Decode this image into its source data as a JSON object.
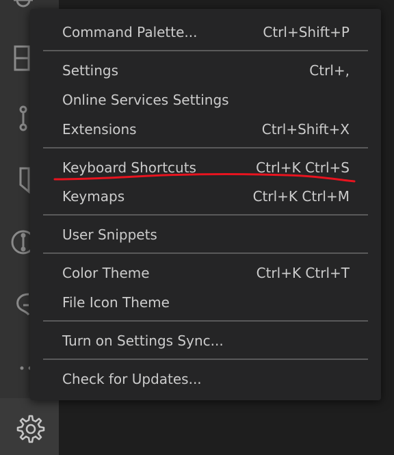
{
  "menu": {
    "items": [
      {
        "label": "Command Palette...",
        "shortcut": "Ctrl+Shift+P"
      },
      {
        "label": "Settings",
        "shortcut": "Ctrl+,"
      },
      {
        "label": "Online Services Settings",
        "shortcut": ""
      },
      {
        "label": "Extensions",
        "shortcut": "Ctrl+Shift+X"
      },
      {
        "label": "Keyboard Shortcuts",
        "shortcut": "Ctrl+K Ctrl+S"
      },
      {
        "label": "Keymaps",
        "shortcut": "Ctrl+K Ctrl+M"
      },
      {
        "label": "User Snippets",
        "shortcut": ""
      },
      {
        "label": "Color Theme",
        "shortcut": "Ctrl+K Ctrl+T"
      },
      {
        "label": "File Icon Theme",
        "shortcut": ""
      },
      {
        "label": "Turn on Settings Sync...",
        "shortcut": ""
      },
      {
        "label": "Check for Updates...",
        "shortcut": ""
      }
    ]
  },
  "activity_bar": {
    "icons": [
      "debug-icon",
      "extensions-icon",
      "source-control-icon",
      "bookmark-icon",
      "timeline-icon",
      "remote-icon",
      "more-icon",
      "gear-icon"
    ]
  },
  "colors": {
    "menu_background": "#252526",
    "menu_text": "#cccccc",
    "separator": "#5a5a5a",
    "activity_bar": "#333333",
    "annotation_underline": "#e8141f"
  }
}
